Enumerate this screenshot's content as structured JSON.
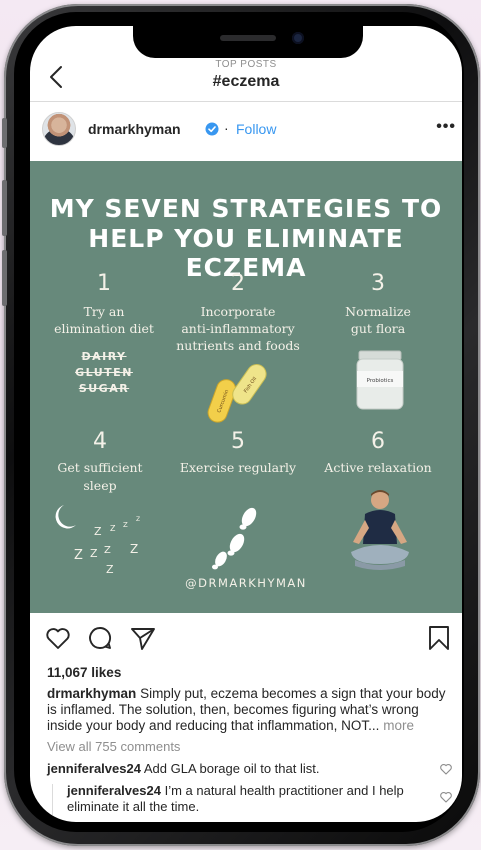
{
  "header": {
    "kicker": "TOP POSTS",
    "title": "#eczema"
  },
  "post": {
    "username": "drmarkhyman",
    "separator": "·",
    "follow_label": "Follow",
    "more_label": "•••",
    "image": {
      "title_line1": "MY SEVEN STRATEGIES TO",
      "title_line2": "HELP YOU ELIMINATE ECZEMA",
      "steps": [
        {
          "number": "1",
          "line1": "Try an",
          "line2": "elimination diet"
        },
        {
          "number": "2",
          "line1": "Incorporate",
          "line2": "anti-inflammatory",
          "line3": "nutrients and foods"
        },
        {
          "number": "3",
          "line1": "Normalize",
          "line2": "gut flora"
        },
        {
          "number": "4",
          "line1": "Get sufficient",
          "line2": "sleep"
        },
        {
          "number": "5",
          "line1": "Exercise regularly"
        },
        {
          "number": "6",
          "line1": "Active relaxation"
        }
      ],
      "eliminate_items": [
        "DAIRY",
        "GLUTEN",
        "SUGAR"
      ],
      "pill_labels": [
        "Curcumin",
        "Fish Oil"
      ],
      "jar_label": "Probiotics",
      "zzz": [
        "Z",
        "Z",
        "Z",
        "Z",
        "Z",
        "Z",
        "Z",
        "Z",
        "Z"
      ],
      "handle": "@DRMARKHYMAN"
    },
    "likes": "11,067 likes",
    "caption_user": "drmarkhyman",
    "caption_text": "Simply put, eczema becomes a sign that your body is inflamed. The solution, then, becomes figuring what’s wrong inside your body and reducing that inflammation, NOT...",
    "caption_more": "more",
    "view_all_comments": "View all 755 comments",
    "comments": [
      {
        "user": "jenniferalves24",
        "text": "Add GLA borage oil to that list."
      },
      {
        "user": "jenniferalves24",
        "text": "I’m a natural health practitioner and I help eliminate it all the time."
      }
    ]
  },
  "colors": {
    "post_bg": "#67897b",
    "link_blue": "#3897f0",
    "pill_yellow": "#f2cf4a",
    "jar": "#e8ece9"
  }
}
